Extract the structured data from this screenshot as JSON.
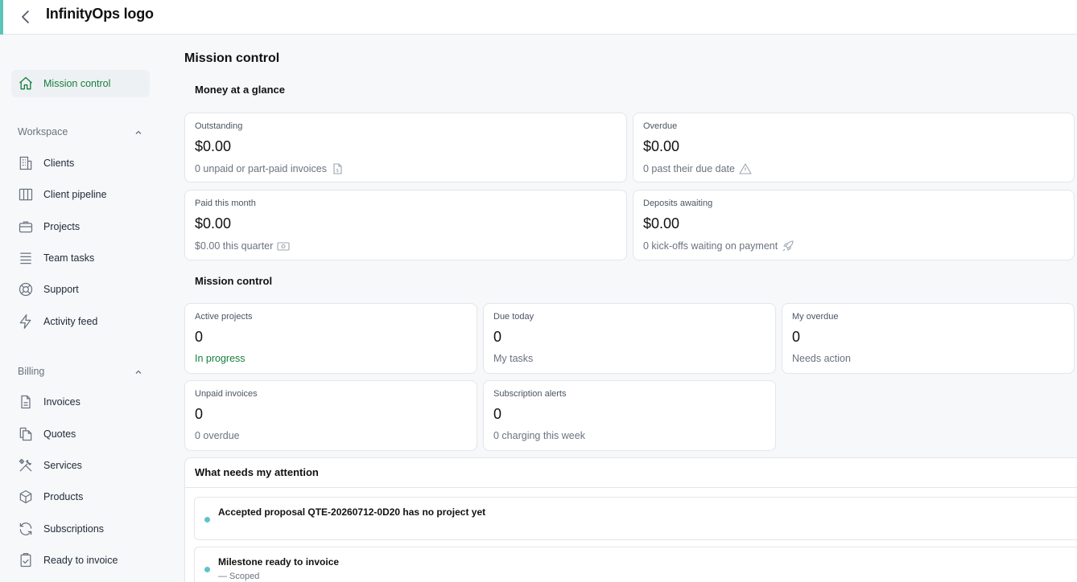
{
  "topbar": {
    "logo": "InfinityOps logo"
  },
  "sidebar": {
    "primary": {
      "label": "Mission control",
      "icon": "home-icon"
    },
    "workspace": {
      "title": "Workspace",
      "items": [
        {
          "label": "Clients",
          "icon": "building-icon"
        },
        {
          "label": "Client pipeline",
          "icon": "columns-icon"
        },
        {
          "label": "Projects",
          "icon": "briefcase-icon"
        },
        {
          "label": "Team tasks",
          "icon": "list-icon"
        },
        {
          "label": "Support",
          "icon": "lifebuoy-icon"
        },
        {
          "label": "Activity feed",
          "icon": "bolt-icon"
        }
      ]
    },
    "billing": {
      "title": "Billing",
      "items": [
        {
          "label": "Invoices",
          "icon": "document-icon"
        },
        {
          "label": "Quotes",
          "icon": "copy-icon"
        },
        {
          "label": "Services",
          "icon": "tools-icon"
        },
        {
          "label": "Products",
          "icon": "box-icon"
        },
        {
          "label": "Subscriptions",
          "icon": "refresh-icon"
        },
        {
          "label": "Ready to invoice",
          "icon": "clipboard-icon"
        }
      ]
    }
  },
  "main": {
    "title": "Mission control",
    "money": {
      "title": "Money at a glance",
      "cards": [
        {
          "label": "Outstanding",
          "value": "$0.00",
          "sub": "0 unpaid or part-paid invoices",
          "icon": "invoice-dollar-icon"
        },
        {
          "label": "Overdue",
          "value": "$0.00",
          "sub": "0 past their due date",
          "icon": "warning-icon"
        },
        {
          "label": "Paid this month",
          "value": "$0.00",
          "sub": "$0.00 this quarter",
          "icon": "cash-icon"
        },
        {
          "label": "Deposits awaiting",
          "value": "$0.00",
          "sub": "0 kick-offs waiting on payment",
          "icon": "rocket-icon"
        }
      ]
    },
    "mission": {
      "title": "Mission control",
      "cards": [
        {
          "label": "Active projects",
          "value": "0",
          "sub": "In progress"
        },
        {
          "label": "Due today",
          "value": "0",
          "sub": "My tasks"
        },
        {
          "label": "My overdue",
          "value": "0",
          "sub": "Needs action"
        },
        {
          "label": "Unpaid invoices",
          "value": "0",
          "sub": "0 overdue"
        },
        {
          "label": "Subscription alerts",
          "value": "0",
          "sub": "0 charging this week"
        }
      ]
    },
    "attention": {
      "title": "What needs my attention",
      "items": [
        {
          "title": "Accepted proposal QTE-20260712-0D20 has no project yet",
          "sub": ""
        },
        {
          "title": "Milestone ready to invoice",
          "sub": "— Scoped"
        }
      ]
    }
  },
  "colors": {
    "accent": "#5ec3b8",
    "active_green": "#16803c",
    "dot": "#5ec3cb"
  }
}
